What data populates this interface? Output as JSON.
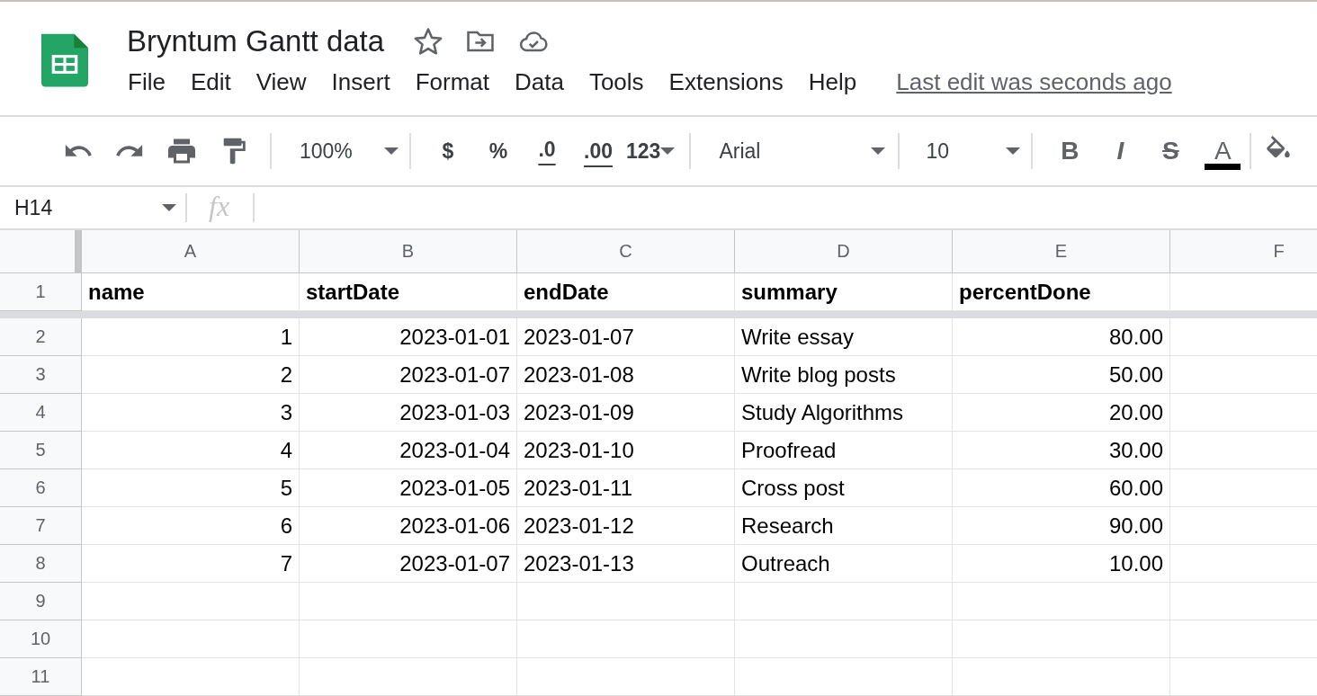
{
  "document": {
    "title": "Bryntum Gantt data",
    "starred": false
  },
  "menu": [
    "File",
    "Edit",
    "View",
    "Insert",
    "Format",
    "Data",
    "Tools",
    "Extensions",
    "Help"
  ],
  "last_edit": "Last edit was seconds ago",
  "toolbar": {
    "zoom": "100%",
    "currency": "$",
    "percent": "%",
    "decrease_decimals": ".0",
    "increase_decimals": ".00",
    "more_formats": "123",
    "font": "Arial",
    "font_size": "10",
    "bold": "B",
    "italic": "I",
    "strikethrough": "S",
    "text_color": "A"
  },
  "formula_bar": {
    "cell_reference": "H14",
    "fx": "fx"
  },
  "grid": {
    "columns": [
      "A",
      "B",
      "C",
      "D",
      "E",
      "F"
    ],
    "frozen_rows": [
      {
        "number": "1",
        "cells": [
          {
            "text": "name",
            "kind": "heading"
          },
          {
            "text": "startDate",
            "kind": "heading"
          },
          {
            "text": "endDate",
            "kind": "heading"
          },
          {
            "text": "summary",
            "kind": "heading"
          },
          {
            "text": "percentDone",
            "kind": "heading"
          }
        ]
      }
    ],
    "rows": [
      {
        "number": "2",
        "cells": [
          {
            "text": "1",
            "kind": "number"
          },
          {
            "text": "2023-01-01",
            "kind": "number"
          },
          {
            "text": "2023-01-07",
            "kind": "text"
          },
          {
            "text": "Write essay",
            "kind": "text"
          },
          {
            "text": "80.00",
            "kind": "number"
          }
        ]
      },
      {
        "number": "3",
        "cells": [
          {
            "text": "2",
            "kind": "number"
          },
          {
            "text": "2023-01-07",
            "kind": "number"
          },
          {
            "text": "2023-01-08",
            "kind": "text"
          },
          {
            "text": "Write blog posts",
            "kind": "text"
          },
          {
            "text": "50.00",
            "kind": "number"
          }
        ]
      },
      {
        "number": "4",
        "cells": [
          {
            "text": "3",
            "kind": "number"
          },
          {
            "text": "2023-01-03",
            "kind": "number"
          },
          {
            "text": "2023-01-09",
            "kind": "text"
          },
          {
            "text": "Study Algorithms",
            "kind": "text"
          },
          {
            "text": "20.00",
            "kind": "number"
          }
        ]
      },
      {
        "number": "5",
        "cells": [
          {
            "text": "4",
            "kind": "number"
          },
          {
            "text": "2023-01-04",
            "kind": "number"
          },
          {
            "text": "2023-01-10",
            "kind": "text"
          },
          {
            "text": "Proofread",
            "kind": "text"
          },
          {
            "text": "30.00",
            "kind": "number"
          }
        ]
      },
      {
        "number": "6",
        "cells": [
          {
            "text": "5",
            "kind": "number"
          },
          {
            "text": "2023-01-05",
            "kind": "number"
          },
          {
            "text": "2023-01-11",
            "kind": "text"
          },
          {
            "text": "Cross post",
            "kind": "text"
          },
          {
            "text": "60.00",
            "kind": "number"
          }
        ]
      },
      {
        "number": "7",
        "cells": [
          {
            "text": "6",
            "kind": "number"
          },
          {
            "text": "2023-01-06",
            "kind": "number"
          },
          {
            "text": "2023-01-12",
            "kind": "text"
          },
          {
            "text": "Research",
            "kind": "text"
          },
          {
            "text": "90.00",
            "kind": "number"
          }
        ]
      },
      {
        "number": "8",
        "cells": [
          {
            "text": "7",
            "kind": "number"
          },
          {
            "text": "2023-01-07",
            "kind": "number"
          },
          {
            "text": "2023-01-13",
            "kind": "text"
          },
          {
            "text": "Outreach",
            "kind": "text"
          },
          {
            "text": "10.00",
            "kind": "number"
          }
        ]
      },
      {
        "number": "9"
      },
      {
        "number": "10"
      },
      {
        "number": "11"
      }
    ]
  }
}
